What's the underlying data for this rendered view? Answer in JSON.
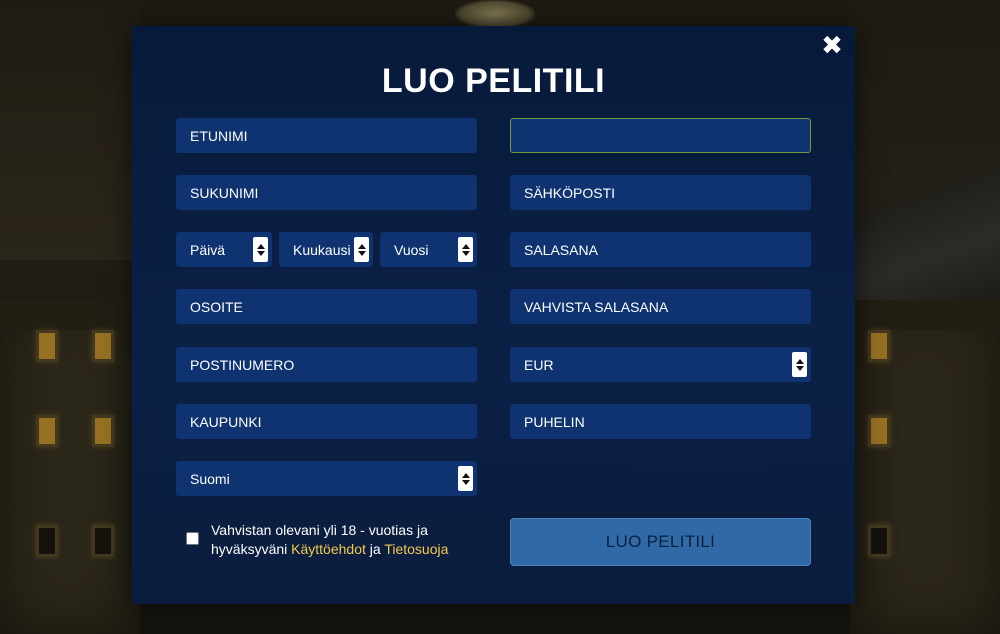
{
  "modal": {
    "title": "LUO PELITILI",
    "close_icon": "close-icon"
  },
  "left_fields": {
    "first_name": "ETUNIMI",
    "last_name": "SUKUNIMI",
    "day": "Päivä",
    "month": "Kuukausi",
    "year": "Vuosi",
    "address": "OSOITE",
    "postal_code": "POSTINUMERO",
    "city": "KAUPUNKI",
    "country": "Suomi"
  },
  "right_fields": {
    "username": "",
    "email": "SÄHKÖPOSTI",
    "password": "SALASANA",
    "confirm_password": "VAHVISTA SALASANA",
    "currency": "EUR",
    "phone": "PUHELIN"
  },
  "consent": {
    "text_before": "Vahvistan olevani yli 18 - vuotias ja hyväksyväni ",
    "terms_link": "Käyttöehdot",
    "conjunction": " ja ",
    "privacy_link": "Tietosuoja",
    "checked": false
  },
  "submit": {
    "label": "LUO PELITILI"
  },
  "colors": {
    "modal_bg": "#0a2045",
    "field_bg": "#0e3370",
    "link": "#f3c94e",
    "button_bg": "#2f6aa6",
    "active_border": "#6f9a3e"
  }
}
